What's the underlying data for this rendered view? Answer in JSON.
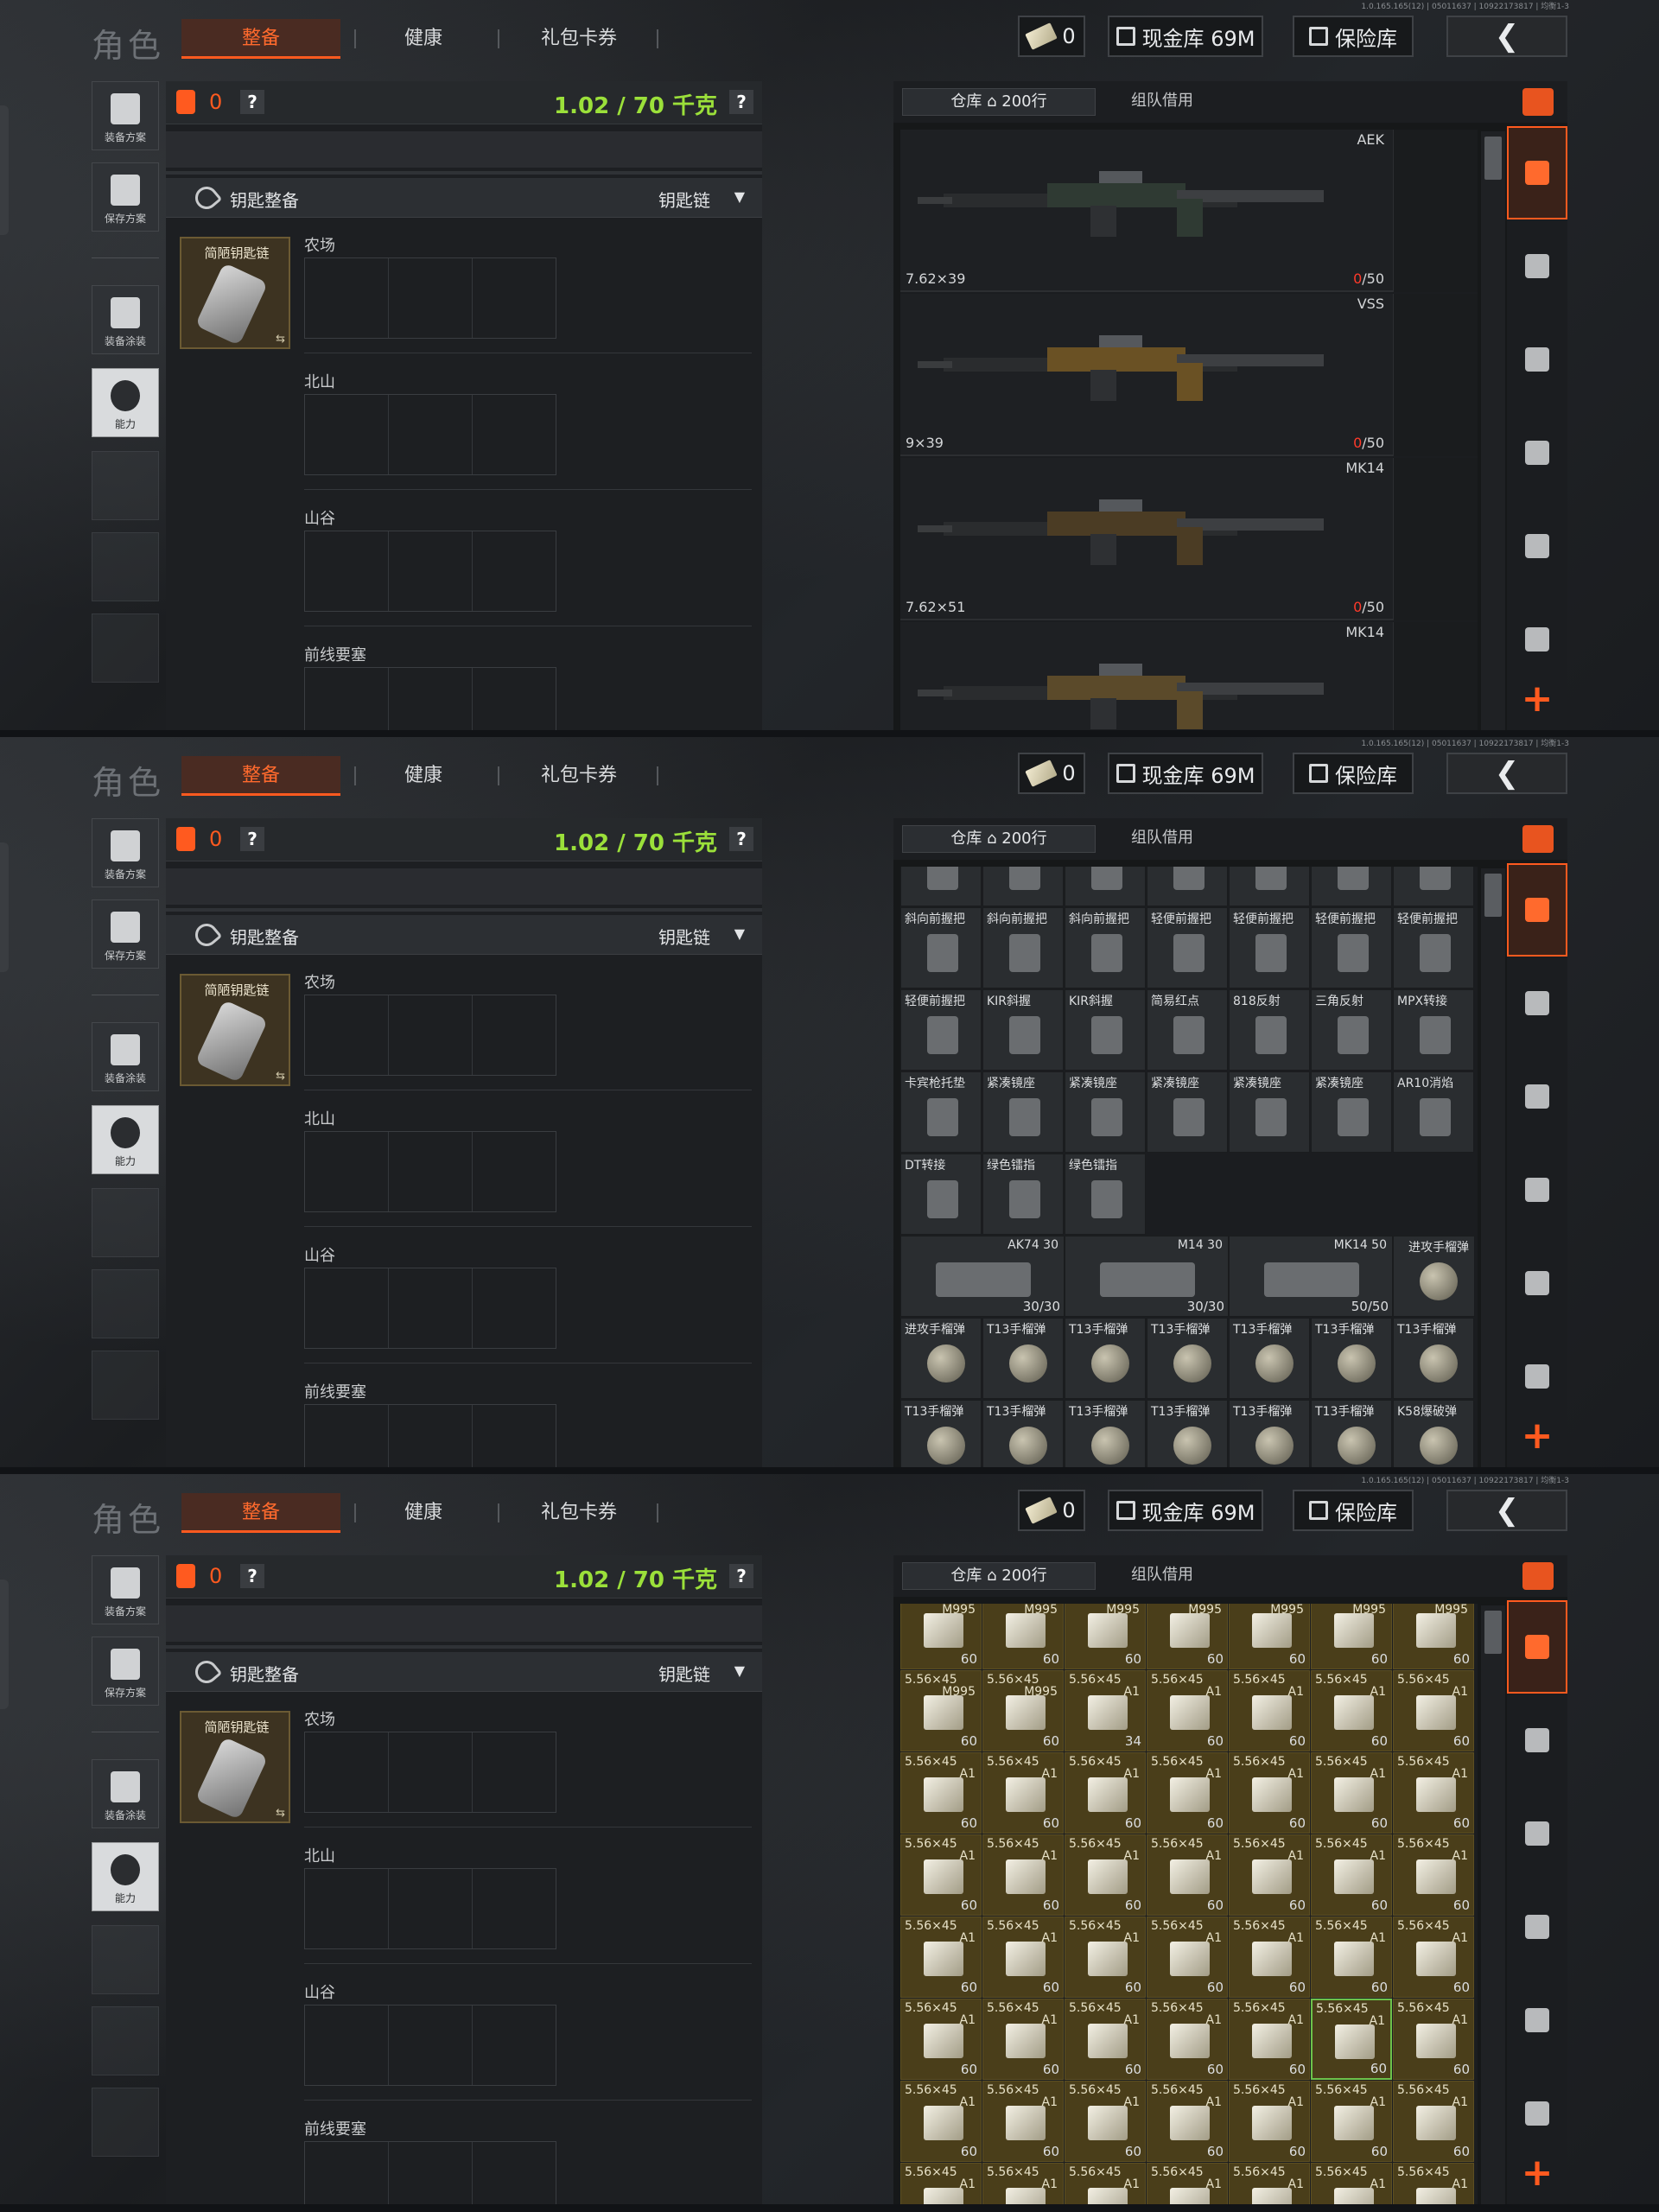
{
  "version": "1.0.165.165(12) | 05011637 | 10922173817 | 均衡1-3",
  "top": {
    "title": "角色",
    "tabs": [
      "整备",
      "健康",
      "礼包卡券"
    ],
    "tickets": "0",
    "cash": "现金库 69M",
    "safe": "保险库"
  },
  "left_buttons": {
    "loadout": "装备方案",
    "save": "保存方案",
    "skin": "装备涂装",
    "ability": "能力"
  },
  "center": {
    "bag_count": "0",
    "help": "?",
    "weight": "1.02 / 70 千克",
    "key_title": "钥匙整备",
    "key_chain": "钥匙链",
    "key_item": "简陋钥匙链",
    "maps": [
      "农场",
      "北山",
      "山谷",
      "前线要塞"
    ]
  },
  "inventory": {
    "tab_storage": "仓库",
    "rows": "200行",
    "tab_team": "组队借用"
  },
  "screen1_guns": [
    {
      "name": "AEK",
      "caliber": "7.62×39",
      "ammo_cur": "0",
      "ammo_max": "/50"
    },
    {
      "name": "VSS",
      "caliber": "9×39",
      "ammo_cur": "0",
      "ammo_max": "/50"
    },
    {
      "name": "MK14",
      "caliber": "7.62×51",
      "ammo_cur": "0",
      "ammo_max": "/50"
    },
    {
      "name": "MK14",
      "caliber": "",
      "ammo_cur": "",
      "ammo_max": ""
    }
  ],
  "screen2_items": [
    [
      "斜向前握把",
      "斜向前握把",
      "斜向前握把",
      "轻便前握把",
      "轻便前握把",
      "轻便前握把",
      "轻便前握把"
    ],
    [
      "轻便前握把",
      "KIR斜握",
      "KIR斜握",
      "简易红点",
      "818反射",
      "三角反射",
      "MPX转接"
    ],
    [
      "卡宾枪托垫",
      "紧凑镜座",
      "紧凑镜座",
      "紧凑镜座",
      "紧凑镜座",
      "紧凑镜座",
      "AR10消焰"
    ],
    [
      "DT转接",
      "绿色镭指",
      "绿色镭指"
    ],
    [
      "进攻手榴弹",
      "T13手榴弹",
      "T13手榴弹",
      "T13手榴弹",
      "T13手榴弹",
      "T13手榴弹",
      "T13手榴弹"
    ],
    [
      "T13手榴弹",
      "T13手榴弹",
      "T13手榴弹",
      "T13手榴弹",
      "T13手榴弹",
      "T13手榴弹",
      "K58爆破弹"
    ]
  ],
  "screen2_mags": [
    {
      "name": "AK74 30",
      "count": "30/30"
    },
    {
      "name": "M14 30",
      "count": "30/30"
    },
    {
      "name": "MK14 50",
      "count": "50/50"
    },
    {
      "name": "进攻手榴弹",
      "count": ""
    }
  ],
  "screen3_ammo": {
    "name": "5.56×45",
    "row0": [
      {
        "sub": "M995",
        "n": "60"
      },
      {
        "sub": "M995",
        "n": "60"
      },
      {
        "sub": "M995",
        "n": "60"
      },
      {
        "sub": "M995",
        "n": "60"
      },
      {
        "sub": "M995",
        "n": "60"
      },
      {
        "sub": "M995",
        "n": "60"
      },
      {
        "sub": "M995",
        "n": "60"
      }
    ],
    "row1": [
      {
        "sub": "M995",
        "n": "60"
      },
      {
        "sub": "M995",
        "n": "60"
      },
      {
        "sub": "A1",
        "n": "34"
      },
      {
        "sub": "A1",
        "n": "60"
      },
      {
        "sub": "A1",
        "n": "60"
      },
      {
        "sub": "A1",
        "n": "60"
      },
      {
        "sub": "A1",
        "n": "60"
      }
    ],
    "default": {
      "sub": "A1",
      "n": "60"
    }
  }
}
